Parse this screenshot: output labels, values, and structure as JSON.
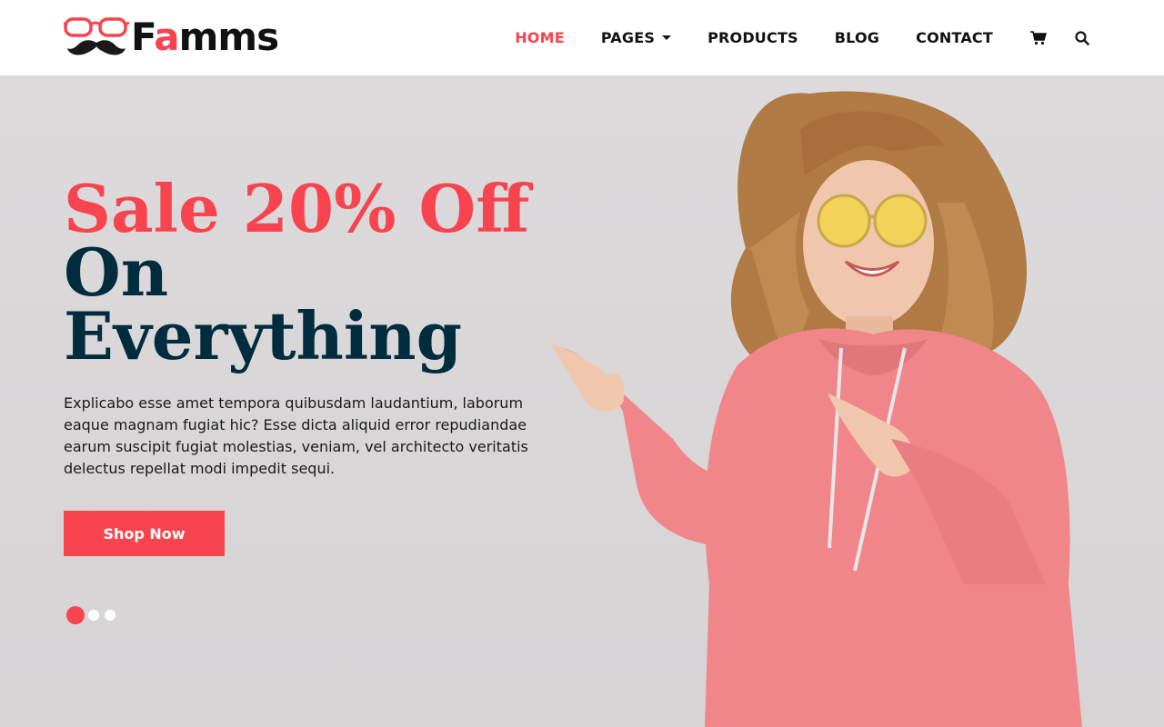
{
  "brand": {
    "name_prefix": "F",
    "name_accent": "a",
    "name_suffix": "mms",
    "logo_icon": "glasses-mustache-icon",
    "accent_color": "#f7444e",
    "dark_color": "#002c3e"
  },
  "nav": {
    "items": [
      {
        "label": "HOME",
        "active": true
      },
      {
        "label": "PAGES",
        "active": false,
        "dropdown": true
      },
      {
        "label": "PRODUCTS",
        "active": false
      },
      {
        "label": "BLOG",
        "active": false
      },
      {
        "label": "CONTACT",
        "active": false
      }
    ],
    "cart_icon": "cart-icon",
    "search_icon": "search-icon"
  },
  "hero": {
    "headline_line1": "Sale 20% Off",
    "headline_line2": "On Everything",
    "description": "Explicabo esse amet tempora quibusdam laudantium, laborum eaque magnam fugiat hic? Esse dicta aliquid error repudiandae earum suscipit fugiat molestias, veniam, vel architecto veritatis delectus repellat modi impedit sequi.",
    "cta_label": "Shop Now",
    "slides": {
      "count": 3,
      "active": 1
    }
  }
}
